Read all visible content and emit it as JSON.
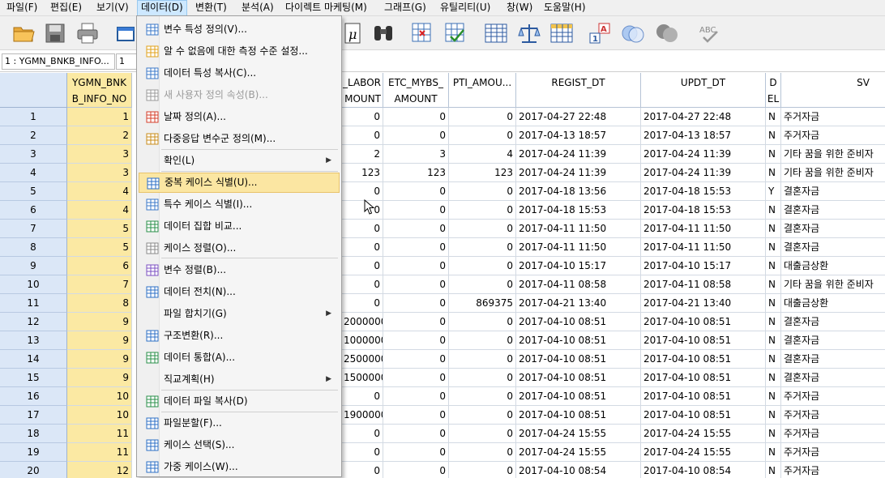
{
  "menubar": {
    "items": [
      {
        "label": "파일(F)"
      },
      {
        "label": "편집(E)"
      },
      {
        "label": "보기(V)"
      },
      {
        "label": "데이터(D)",
        "active": true
      },
      {
        "label": "변환(T)"
      },
      {
        "label": "분석(A)"
      },
      {
        "label": "다이렉트 마케팅(M)"
      },
      {
        "label": "그래프(G)"
      },
      {
        "label": "유틸리티(U)"
      },
      {
        "label": "창(W)"
      },
      {
        "label": "도움말(H)"
      }
    ]
  },
  "toolbar": {
    "icons": [
      "open-folder-icon",
      "save-icon",
      "print-icon",
      "dialog-recall-icon",
      "variable-mu-icon",
      "find-binoculars-icon",
      "insert-cases-icon",
      "insert-variable-icon",
      "split-file-icon",
      "weight-cases-icon",
      "select-cases-icon",
      "value-labels-icon",
      "use-sets-icon",
      "show-all-icon",
      "spellcheck-icon"
    ]
  },
  "refbar": {
    "name": "1 : YGMN_BNKB_INFO...",
    "value": "1"
  },
  "columns": [
    {
      "header": "YGMN_BNK\nB_INFO_NO"
    },
    {
      "header": "_LABOR\nMOUNT"
    },
    {
      "header": "ETC_MYBS_\nAMOUNT"
    },
    {
      "header": "PTI_AMOU..."
    },
    {
      "header": "REGIST_DT"
    },
    {
      "header": "UPDT_DT"
    },
    {
      "header": "D\nEL"
    },
    {
      "header": "SV"
    }
  ],
  "rows": [
    {
      "n": "1",
      "id": "1",
      "labor": "0",
      "etc": "0",
      "pti": "0",
      "regist": "2017-04-27 22:48",
      "updt": "2017-04-27 22:48",
      "del": "N",
      "sv": "주거자금"
    },
    {
      "n": "2",
      "id": "2",
      "labor": "0",
      "etc": "0",
      "pti": "0",
      "regist": "2017-04-13 18:57",
      "updt": "2017-04-13 18:57",
      "del": "N",
      "sv": "주거자금"
    },
    {
      "n": "3",
      "id": "3",
      "labor": "2",
      "etc": "3",
      "pti": "4",
      "regist": "2017-04-24 11:39",
      "updt": "2017-04-24 11:39",
      "del": "N",
      "sv": "기타 꿈을 위한 준비자"
    },
    {
      "n": "4",
      "id": "3",
      "labor": "123",
      "etc": "123",
      "pti": "123",
      "regist": "2017-04-24 11:39",
      "updt": "2017-04-24 11:39",
      "del": "N",
      "sv": "기타 꿈을 위한 준비자"
    },
    {
      "n": "5",
      "id": "4",
      "labor": "0",
      "etc": "0",
      "pti": "0",
      "regist": "2017-04-18 13:56",
      "updt": "2017-04-18 15:53",
      "del": "Y",
      "sv": "결혼자금"
    },
    {
      "n": "6",
      "id": "4",
      "labor": "0",
      "etc": "0",
      "pti": "0",
      "regist": "2017-04-18 15:53",
      "updt": "2017-04-18 15:53",
      "del": "N",
      "sv": "결혼자금"
    },
    {
      "n": "7",
      "id": "5",
      "labor": "0",
      "etc": "0",
      "pti": "0",
      "regist": "2017-04-11 11:50",
      "updt": "2017-04-11 11:50",
      "del": "N",
      "sv": "결혼자금"
    },
    {
      "n": "8",
      "id": "5",
      "labor": "0",
      "etc": "0",
      "pti": "0",
      "regist": "2017-04-11 11:50",
      "updt": "2017-04-11 11:50",
      "del": "N",
      "sv": "결혼자금"
    },
    {
      "n": "9",
      "id": "6",
      "labor": "0",
      "etc": "0",
      "pti": "0",
      "regist": "2017-04-10 15:17",
      "updt": "2017-04-10 15:17",
      "del": "N",
      "sv": "대출금상환"
    },
    {
      "n": "10",
      "id": "7",
      "labor": "0",
      "etc": "0",
      "pti": "0",
      "regist": "2017-04-11 08:58",
      "updt": "2017-04-11 08:58",
      "del": "N",
      "sv": "기타 꿈을 위한 준비자"
    },
    {
      "n": "11",
      "id": "8",
      "labor": "0",
      "etc": "0",
      "pti": "869375",
      "regist": "2017-04-21 13:40",
      "updt": "2017-04-21 13:40",
      "del": "N",
      "sv": "대출금상환"
    },
    {
      "n": "12",
      "id": "9",
      "labor": "2000000",
      "etc": "0",
      "pti": "0",
      "regist": "2017-04-10 08:51",
      "updt": "2017-04-10 08:51",
      "del": "N",
      "sv": "결혼자금"
    },
    {
      "n": "13",
      "id": "9",
      "labor": "1000000",
      "etc": "0",
      "pti": "0",
      "regist": "2017-04-10 08:51",
      "updt": "2017-04-10 08:51",
      "del": "N",
      "sv": "결혼자금"
    },
    {
      "n": "14",
      "id": "9",
      "labor": "2500000",
      "etc": "0",
      "pti": "0",
      "regist": "2017-04-10 08:51",
      "updt": "2017-04-10 08:51",
      "del": "N",
      "sv": "결혼자금"
    },
    {
      "n": "15",
      "id": "9",
      "labor": "1500000",
      "etc": "0",
      "pti": "0",
      "regist": "2017-04-10 08:51",
      "updt": "2017-04-10 08:51",
      "del": "N",
      "sv": "결혼자금"
    },
    {
      "n": "16",
      "id": "10",
      "labor": "0",
      "etc": "0",
      "pti": "0",
      "regist": "2017-04-10 08:51",
      "updt": "2017-04-10 08:51",
      "del": "N",
      "sv": "주거자금"
    },
    {
      "n": "17",
      "id": "10",
      "labor": "1900000",
      "etc": "0",
      "pti": "0",
      "regist": "2017-04-10 08:51",
      "updt": "2017-04-10 08:51",
      "del": "N",
      "sv": "주거자금"
    },
    {
      "n": "18",
      "id": "11",
      "labor": "0",
      "etc": "0",
      "pti": "0",
      "regist": "2017-04-24 15:55",
      "updt": "2017-04-24 15:55",
      "del": "N",
      "sv": "주거자금"
    },
    {
      "n": "19",
      "id": "11",
      "labor": "0",
      "etc": "0",
      "pti": "0",
      "regist": "2017-04-24 15:55",
      "updt": "2017-04-24 15:55",
      "del": "N",
      "sv": "주거자금"
    },
    {
      "n": "20",
      "id": "12",
      "labor": "0",
      "etc": "0",
      "pti": "0",
      "regist": "2017-04-10 08:54",
      "updt": "2017-04-10 08:54",
      "del": "N",
      "sv": "주거자금"
    }
  ],
  "dropdown": {
    "items": [
      {
        "label": "변수 특성 정의(V)...",
        "icon": "define-variable-properties-icon"
      },
      {
        "label": "알 수 없음에 대한 측정 수준 설정...",
        "icon": "unknown-measure-icon"
      },
      {
        "label": "데이터 특성 복사(C)...",
        "icon": "copy-properties-icon"
      },
      {
        "label": "새 사용자 정의 속성(B)...",
        "icon": "custom-attribute-icon",
        "disabled": true
      },
      {
        "label": "날짜 정의(A)...",
        "icon": "define-dates-icon"
      },
      {
        "label": "다중응답 변수군 정의(M)...",
        "icon": "multiple-response-icon"
      },
      {
        "label": "확인(L)",
        "submenu": true
      },
      {
        "label": "중복 케이스 식별(U)...",
        "icon": "duplicate-cases-icon",
        "highlight": true
      },
      {
        "label": "특수 케이스 식별(I)...",
        "icon": "unusual-cases-icon"
      },
      {
        "label": "데이터 집합 비교...",
        "icon": "compare-datasets-icon"
      },
      {
        "label": "케이스 정렬(O)...",
        "icon": "sort-cases-icon"
      },
      {
        "label": "변수 정렬(B)...",
        "icon": "sort-variables-icon"
      },
      {
        "label": "데이터 전치(N)...",
        "icon": "transpose-icon"
      },
      {
        "label": "파일 합치기(G)",
        "submenu": true
      },
      {
        "label": "구조변환(R)...",
        "icon": "restructure-icon"
      },
      {
        "label": "데이터 통합(A)...",
        "icon": "aggregate-icon"
      },
      {
        "label": "직교계획(H)",
        "submenu": true
      },
      {
        "label": "데이터 파일 복사(D)",
        "icon": "copy-dataset-icon"
      },
      {
        "label": "파일분할(F)...",
        "icon": "split-file-menu-icon"
      },
      {
        "label": "케이스 선택(S)...",
        "icon": "select-cases-menu-icon"
      },
      {
        "label": "가중 케이스(W)...",
        "icon": "weight-cases-menu-icon"
      }
    ]
  }
}
